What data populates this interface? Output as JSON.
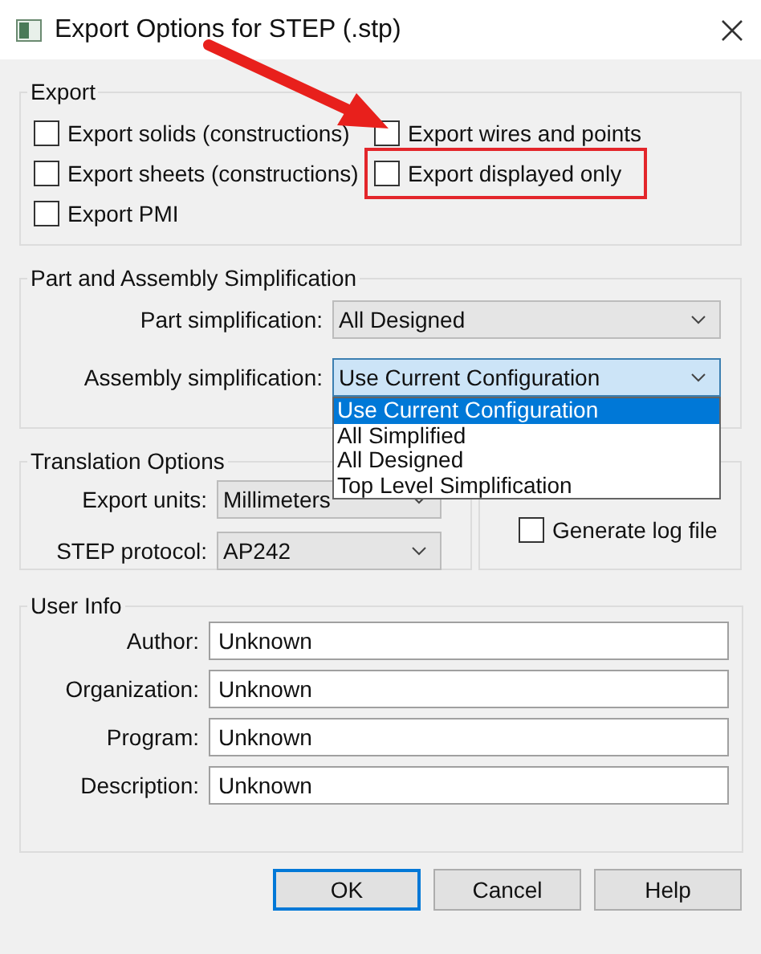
{
  "window": {
    "title": "Export Options for STEP (.stp)"
  },
  "export": {
    "title": "Export",
    "options": [
      {
        "label": "Export solids (constructions)",
        "checked": false,
        "highlighted": false
      },
      {
        "label": "Export wires and points",
        "checked": false,
        "highlighted": false
      },
      {
        "label": "Export sheets (constructions)",
        "checked": false,
        "highlighted": false
      },
      {
        "label": "Export displayed only",
        "checked": false,
        "highlighted": true
      },
      {
        "label": "Export PMI",
        "checked": false,
        "highlighted": false
      }
    ]
  },
  "simplification": {
    "title": "Part and Assembly Simplification",
    "fields": [
      {
        "label": "Part simplification:",
        "value": "All Designed",
        "focused": false
      },
      {
        "label": "Assembly simplification:",
        "value": "Use Current Configuration",
        "focused": true
      }
    ],
    "dropdown_items": [
      {
        "label": "Use Current Configuration",
        "selected": true
      },
      {
        "label": "All Simplified",
        "selected": false
      },
      {
        "label": "All Designed",
        "selected": false
      },
      {
        "label": "Top Level Simplification",
        "selected": false
      }
    ]
  },
  "translation": {
    "title": "Translation Options",
    "fields": [
      {
        "label": "Export units:",
        "value": "Millimeters"
      },
      {
        "label": "STEP protocol:",
        "value": "AP242"
      }
    ],
    "log_option": {
      "label": "Generate log file",
      "checked": false
    }
  },
  "user_info": {
    "title": "User Info",
    "fields": [
      {
        "label": "Author:",
        "value": "Unknown"
      },
      {
        "label": "Organization:",
        "value": "Unknown"
      },
      {
        "label": "Program:",
        "value": "Unknown"
      },
      {
        "label": "Description:",
        "value": "Unknown"
      }
    ]
  },
  "buttons": [
    {
      "label": "OK",
      "default": true
    },
    {
      "label": "Cancel",
      "default": false
    },
    {
      "label": "Help",
      "default": false
    }
  ]
}
